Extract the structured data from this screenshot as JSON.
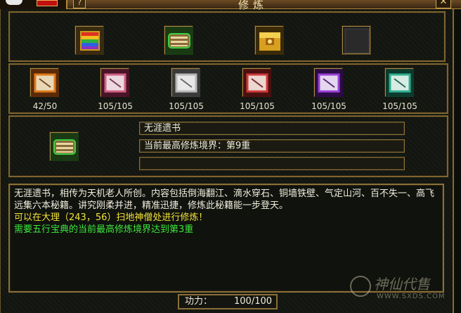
{
  "window": {
    "title": "修炼",
    "help_label": "?",
    "close_label": "✕"
  },
  "book_slots": [
    {
      "icon": "rainbow-book-icon"
    },
    {
      "icon": "green-scroll-icon"
    },
    {
      "icon": "gold-treasure-icon"
    },
    {
      "icon": "empty-slot-icon"
    }
  ],
  "skills": [
    {
      "icon": "orange-skill-scroll-icon",
      "count": "42/50",
      "color": "#e07a1a"
    },
    {
      "icon": "pink-skill-scroll-icon",
      "count": "105/105",
      "color": "#d06080"
    },
    {
      "icon": "silver-skill-scroll-icon",
      "count": "105/105",
      "color": "#b8b8b8"
    },
    {
      "icon": "red-skill-scroll-icon",
      "count": "105/105",
      "color": "#d03a3a"
    },
    {
      "icon": "purple-skill-scroll-icon",
      "count": "105/105",
      "color": "#9a40d8"
    },
    {
      "icon": "teal-skill-scroll-icon",
      "count": "105/105",
      "color": "#30b090"
    }
  ],
  "selected": {
    "icon": "green-scroll-icon",
    "name": "无涯遗书",
    "level": "当前最高修炼境界：第9重",
    "extra": ""
  },
  "description": {
    "text": "无涯遗书，相传为天机老人所创。内容包括倒海翻江、滴水穿石、铜墙铁壁、气定山河、百不失一、高飞远集六本秘籍。讲究刚柔并进，精准迅捷，修炼此秘籍能一步登天。",
    "location": "可以在大理（243，56）扫地神僧处进行修炼！",
    "requirement": "需要五行宝典的当前最高修炼境界达到第3重"
  },
  "power": {
    "label": "功力：",
    "value": "100/100"
  },
  "watermark": {
    "name": "神仙代售",
    "url": "WWW.SXDS.COM"
  }
}
